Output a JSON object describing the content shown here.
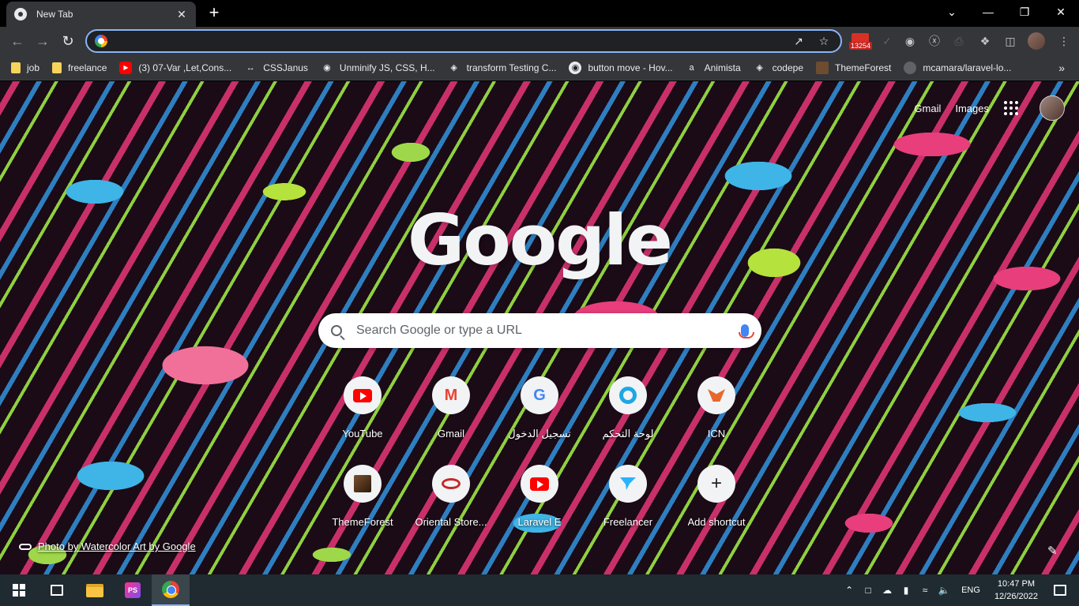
{
  "tab": {
    "title": "New Tab",
    "close": "✕",
    "new_tab": "+"
  },
  "window_controls": {
    "chevron": "⌄",
    "minimize": "—",
    "restore": "❐",
    "close": "✕"
  },
  "omnibox": {
    "value": "",
    "placeholder": ""
  },
  "extension": {
    "badge_count": "13254"
  },
  "bookmarks": [
    {
      "label": "job",
      "icon": "folder-icon"
    },
    {
      "label": "freelance",
      "icon": "folder-icon"
    },
    {
      "label": "(3) 07-Var ,Let,Cons...",
      "icon": "youtube-icon"
    },
    {
      "label": "CSSJanus",
      "icon": "arrows-icon"
    },
    {
      "label": "Unminify JS, CSS, H...",
      "icon": "glasses-icon"
    },
    {
      "label": "transform Testing C...",
      "icon": "codepen-icon"
    },
    {
      "label": "button move - Hov...",
      "icon": "globe-icon"
    },
    {
      "label": "Animista",
      "icon": "animista-icon"
    },
    {
      "label": "codepe",
      "icon": "codepen-icon"
    },
    {
      "label": "ThemeForest",
      "icon": "themeforest-icon"
    },
    {
      "label": "mcamara/laravel-lo...",
      "icon": "github-icon"
    }
  ],
  "bookmarks_more": "»",
  "header_links": {
    "gmail": "Gmail",
    "images": "Images"
  },
  "logo_text": "Google",
  "search": {
    "placeholder": "Search Google or type a URL"
  },
  "shortcuts": [
    {
      "label": "YouTube",
      "icon": "youtube-icon"
    },
    {
      "label": "Gmail",
      "icon": "gmail-icon"
    },
    {
      "label": "تسجيل الدخول",
      "icon": "google-icon"
    },
    {
      "label": "لوحة التحكم",
      "icon": "ring-icon"
    },
    {
      "label": "ICN",
      "icon": "icn-icon"
    },
    {
      "label": "ThemeForest",
      "icon": "themeforest-icon"
    },
    {
      "label": "Oriental Store...",
      "icon": "oriental-icon"
    },
    {
      "label": "Laravel E",
      "icon": "youtube-icon"
    },
    {
      "label": "Freelancer",
      "icon": "freelancer-icon"
    },
    {
      "label": "Add shortcut",
      "icon": "plus-icon"
    }
  ],
  "photo_credit": "Photo by Watercolor Art by Google",
  "taskbar": {
    "ps_label": "PS",
    "language": "ENG",
    "time": "10:47 PM",
    "date": "12/26/2022"
  }
}
